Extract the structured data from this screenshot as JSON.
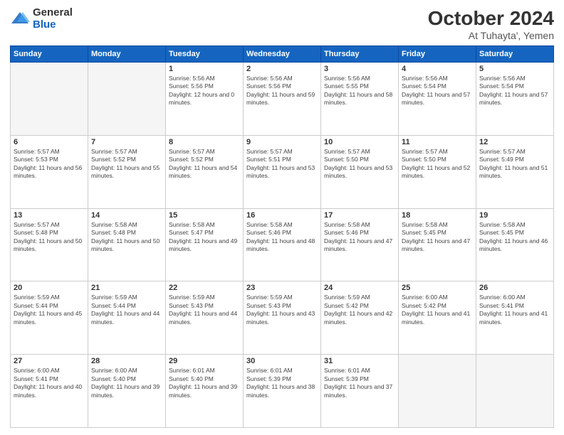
{
  "header": {
    "logo_general": "General",
    "logo_blue": "Blue",
    "month_title": "October 2024",
    "location": "At Tuhayta', Yemen"
  },
  "weekdays": [
    "Sunday",
    "Monday",
    "Tuesday",
    "Wednesday",
    "Thursday",
    "Friday",
    "Saturday"
  ],
  "weeks": [
    [
      {
        "day": "",
        "empty": true
      },
      {
        "day": "",
        "empty": true
      },
      {
        "day": "1",
        "sunrise": "5:56 AM",
        "sunset": "5:56 PM",
        "daylight": "12 hours and 0 minutes."
      },
      {
        "day": "2",
        "sunrise": "5:56 AM",
        "sunset": "5:56 PM",
        "daylight": "11 hours and 59 minutes."
      },
      {
        "day": "3",
        "sunrise": "5:56 AM",
        "sunset": "5:55 PM",
        "daylight": "11 hours and 58 minutes."
      },
      {
        "day": "4",
        "sunrise": "5:56 AM",
        "sunset": "5:54 PM",
        "daylight": "11 hours and 57 minutes."
      },
      {
        "day": "5",
        "sunrise": "5:56 AM",
        "sunset": "5:54 PM",
        "daylight": "11 hours and 57 minutes."
      }
    ],
    [
      {
        "day": "6",
        "sunrise": "5:57 AM",
        "sunset": "5:53 PM",
        "daylight": "11 hours and 56 minutes."
      },
      {
        "day": "7",
        "sunrise": "5:57 AM",
        "sunset": "5:52 PM",
        "daylight": "11 hours and 55 minutes."
      },
      {
        "day": "8",
        "sunrise": "5:57 AM",
        "sunset": "5:52 PM",
        "daylight": "11 hours and 54 minutes."
      },
      {
        "day": "9",
        "sunrise": "5:57 AM",
        "sunset": "5:51 PM",
        "daylight": "11 hours and 53 minutes."
      },
      {
        "day": "10",
        "sunrise": "5:57 AM",
        "sunset": "5:50 PM",
        "daylight": "11 hours and 53 minutes."
      },
      {
        "day": "11",
        "sunrise": "5:57 AM",
        "sunset": "5:50 PM",
        "daylight": "11 hours and 52 minutes."
      },
      {
        "day": "12",
        "sunrise": "5:57 AM",
        "sunset": "5:49 PM",
        "daylight": "11 hours and 51 minutes."
      }
    ],
    [
      {
        "day": "13",
        "sunrise": "5:57 AM",
        "sunset": "5:48 PM",
        "daylight": "11 hours and 50 minutes."
      },
      {
        "day": "14",
        "sunrise": "5:58 AM",
        "sunset": "5:48 PM",
        "daylight": "11 hours and 50 minutes."
      },
      {
        "day": "15",
        "sunrise": "5:58 AM",
        "sunset": "5:47 PM",
        "daylight": "11 hours and 49 minutes."
      },
      {
        "day": "16",
        "sunrise": "5:58 AM",
        "sunset": "5:46 PM",
        "daylight": "11 hours and 48 minutes."
      },
      {
        "day": "17",
        "sunrise": "5:58 AM",
        "sunset": "5:46 PM",
        "daylight": "11 hours and 47 minutes."
      },
      {
        "day": "18",
        "sunrise": "5:58 AM",
        "sunset": "5:45 PM",
        "daylight": "11 hours and 47 minutes."
      },
      {
        "day": "19",
        "sunrise": "5:58 AM",
        "sunset": "5:45 PM",
        "daylight": "11 hours and 46 minutes."
      }
    ],
    [
      {
        "day": "20",
        "sunrise": "5:59 AM",
        "sunset": "5:44 PM",
        "daylight": "11 hours and 45 minutes."
      },
      {
        "day": "21",
        "sunrise": "5:59 AM",
        "sunset": "5:44 PM",
        "daylight": "11 hours and 44 minutes."
      },
      {
        "day": "22",
        "sunrise": "5:59 AM",
        "sunset": "5:43 PM",
        "daylight": "11 hours and 44 minutes."
      },
      {
        "day": "23",
        "sunrise": "5:59 AM",
        "sunset": "5:43 PM",
        "daylight": "11 hours and 43 minutes."
      },
      {
        "day": "24",
        "sunrise": "5:59 AM",
        "sunset": "5:42 PM",
        "daylight": "11 hours and 42 minutes."
      },
      {
        "day": "25",
        "sunrise": "6:00 AM",
        "sunset": "5:42 PM",
        "daylight": "11 hours and 41 minutes."
      },
      {
        "day": "26",
        "sunrise": "6:00 AM",
        "sunset": "5:41 PM",
        "daylight": "11 hours and 41 minutes."
      }
    ],
    [
      {
        "day": "27",
        "sunrise": "6:00 AM",
        "sunset": "5:41 PM",
        "daylight": "11 hours and 40 minutes."
      },
      {
        "day": "28",
        "sunrise": "6:00 AM",
        "sunset": "5:40 PM",
        "daylight": "11 hours and 39 minutes."
      },
      {
        "day": "29",
        "sunrise": "6:01 AM",
        "sunset": "5:40 PM",
        "daylight": "11 hours and 39 minutes."
      },
      {
        "day": "30",
        "sunrise": "6:01 AM",
        "sunset": "5:39 PM",
        "daylight": "11 hours and 38 minutes."
      },
      {
        "day": "31",
        "sunrise": "6:01 AM",
        "sunset": "5:39 PM",
        "daylight": "11 hours and 37 minutes."
      },
      {
        "day": "",
        "empty": true
      },
      {
        "day": "",
        "empty": true
      }
    ]
  ]
}
